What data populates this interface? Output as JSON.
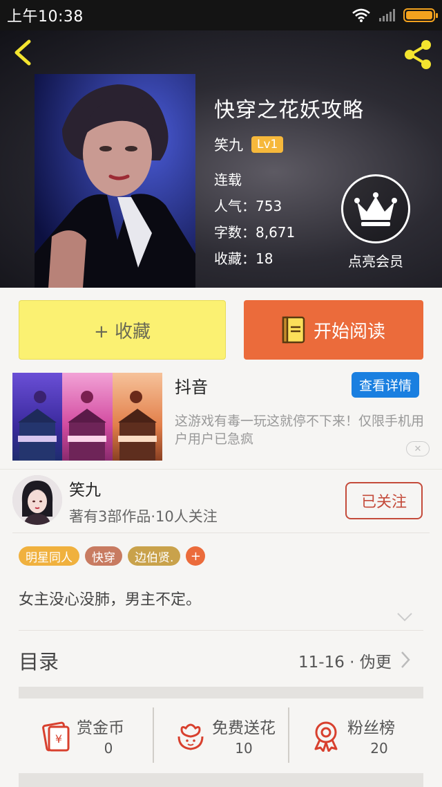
{
  "status_bar": {
    "time": "上午10:38"
  },
  "colors": {
    "accent_orange": "#eb6b3b",
    "collect_yellow": "#fbf172",
    "level_badge": "#f6b83b",
    "follow_red": "#c44a3a",
    "ad_blue": "#1a7fe0"
  },
  "book": {
    "title": "快穿之花妖攻略",
    "author": "笑九",
    "level": "Lv1",
    "status": "连载",
    "popularity": "人气：753",
    "word_count": "字数：8,671",
    "favorites": "收藏：18",
    "vip_label": "点亮会员"
  },
  "actions": {
    "collect_label": "+ 收藏",
    "read_label": "开始阅读"
  },
  "ad": {
    "title": "抖音",
    "detail_button": "查看详情",
    "description": "这游戏有毒一玩这就停不下来！仅限手机用户用户已急疯",
    "close_label": "✕"
  },
  "author_row": {
    "name": "笑九",
    "meta": "著有3部作品·10人关注",
    "follow_label": "已关注"
  },
  "tags": [
    {
      "label": "明星同人",
      "color": "#f0b13e"
    },
    {
      "label": "快穿",
      "color": "#c87b61"
    },
    {
      "label": "边伯贤.",
      "color": "#c9a24b"
    }
  ],
  "tag_add_label": "+",
  "synopsis": "女主没心没肺，男主不定。",
  "catalog": {
    "label": "目录",
    "update": "11-16 · 伪更"
  },
  "bottom_stats": [
    {
      "label": "赏金币",
      "value": "0",
      "icon": "red-envelope-icon"
    },
    {
      "label": "免费送花",
      "value": "10",
      "icon": "flower-icon"
    },
    {
      "label": "粉丝榜",
      "value": "20",
      "icon": "medal-icon"
    }
  ]
}
